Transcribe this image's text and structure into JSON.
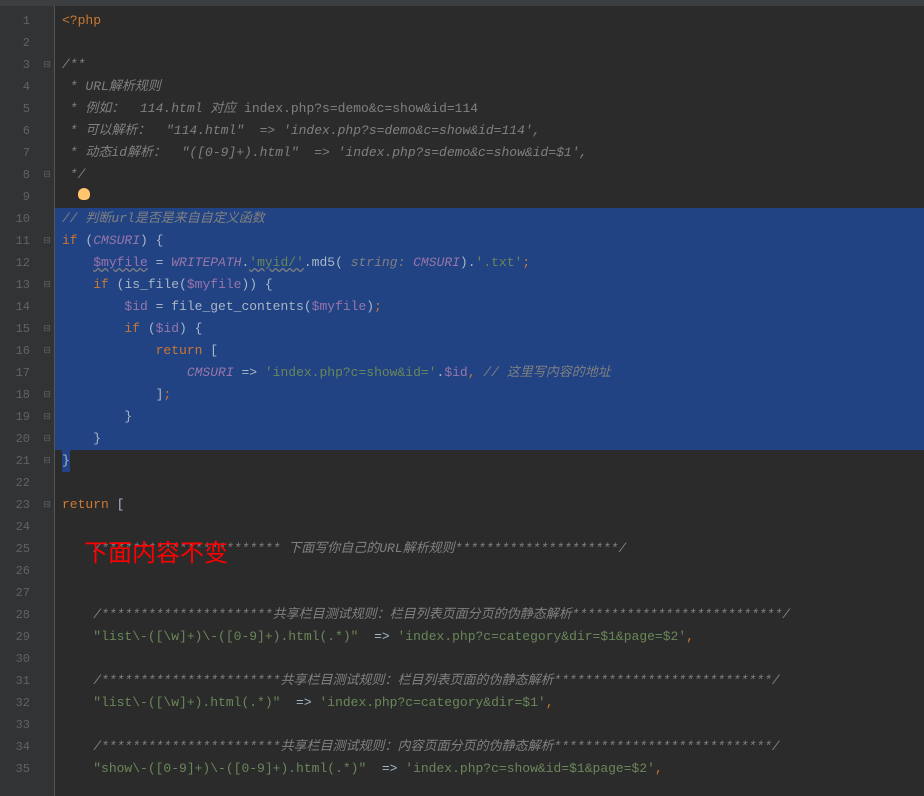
{
  "lineNumbers": [
    "1",
    "2",
    "3",
    "4",
    "5",
    "6",
    "7",
    "8",
    "9",
    "10",
    "11",
    "12",
    "13",
    "14",
    "15",
    "16",
    "17",
    "18",
    "19",
    "20",
    "21",
    "22",
    "23",
    "24",
    "25",
    "26",
    "27",
    "28",
    "29",
    "30",
    "31",
    "32",
    "33",
    "34",
    "35"
  ],
  "foldMarkers": {
    "1": "",
    "3": "⊟",
    "8": "⊟",
    "11": "⊟",
    "13": "⊟",
    "15": "⊟",
    "16": "⊟",
    "18": "⊟",
    "19": "⊟",
    "20": "⊟",
    "21": "⊟",
    "23": "⊟"
  },
  "code": {
    "l1": "<?php",
    "l2": "",
    "l3": "/**",
    "l4": " * URL解析规则",
    "l5_p1": " * 例如：  114.html 对应 ",
    "l5_p2": "index.php?s=demo&c=show&id=114",
    "l6": " * 可以解析：  \"114.html\"  => 'index.php?s=demo&c=show&id=114',",
    "l7": " * 动态id解析：  \"([0-9]+).html\"  => 'index.php?s=demo&c=show&id=$1',",
    "l8": " */",
    "l9": "",
    "l10": "// 判断url是否是来自自定义函数",
    "l11_if": "if",
    "l11_cmsuri": "CMSURI",
    "l12_myfile": "$myfile",
    "l12_eq": " = ",
    "l12_writepath": "WRITEPATH",
    "l12_myid": "'myid/'",
    "l12_md5": ".md5(",
    "l12_typehint": " string: ",
    "l12_cmsuri": "CMSURI",
    "l12_close": ").",
    "l12_txt": "'.txt'",
    "l13_if": "if",
    "l13_isfile": "is_file",
    "l13_myfile": "$myfile",
    "l14_id": "$id",
    "l14_eq": " = ",
    "l14_fgc": "file_get_contents",
    "l14_myfile": "$myfile",
    "l15_if": "if",
    "l15_id": "$id",
    "l16_return": "return",
    "l17_cmsuri": "CMSURI",
    "l17_arrow": " => ",
    "l17_str": "'index.php?c=show&id='",
    "l17_id": "$id",
    "l17_comment": "// 这里写内容的地址",
    "l23_return": "return",
    "l25": "/*********************** 下面写你自己的URL解析规则*********************/",
    "l28": "/**********************共享栏目测试规则：栏目列表页面分页的伪静态解析***************************/",
    "l29_s1": "\"list\\-([\\w]+)\\-([0-9]+).html(.*)\"",
    "l29_arrow": "  => ",
    "l29_s2": "'index.php?c=category&dir=$1&page=$2'",
    "l31": "/***********************共享栏目测试规则：栏目列表页面的伪静态解析****************************/",
    "l32_s1": "\"list\\-([\\w]+).html(.*)\"",
    "l32_arrow": "  => ",
    "l32_s2": "'index.php?c=category&dir=$1'",
    "l34": "/***********************共享栏目测试规则：内容页面分页的伪静态解析****************************/",
    "l35_s1": "\"show\\-([0-9]+)\\-([0-9]+).html(.*)\"",
    "l35_arrow": "  => ",
    "l35_s2": "'index.php?c=show&id=$1&page=$2'"
  },
  "redOverlay": "下面内容不变"
}
